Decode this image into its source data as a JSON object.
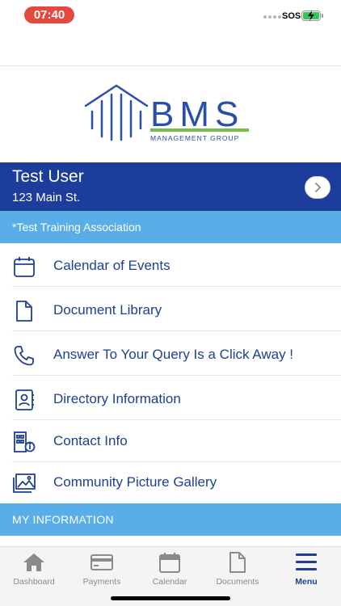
{
  "status_bar": {
    "time": "07:40",
    "carrier": "SOS"
  },
  "logo": {
    "name": "BMS",
    "tagline": "MANAGEMENT GROUP"
  },
  "user": {
    "name": "Test User",
    "address": "123 Main St."
  },
  "association": "*Test Training Association",
  "menu": [
    {
      "label": "Calendar of Events",
      "icon": "calendar-icon"
    },
    {
      "label": "Document Library",
      "icon": "document-icon"
    },
    {
      "label": "Answer To Your Query Is a Click Away !",
      "icon": "phone-icon"
    },
    {
      "label": "Directory Information",
      "icon": "directory-icon"
    },
    {
      "label": "Contact Info",
      "icon": "building-info-icon"
    },
    {
      "label": "Community Picture Gallery",
      "icon": "gallery-icon"
    }
  ],
  "section_header": "MY INFORMATION",
  "tabs": [
    {
      "label": "Dashboard",
      "icon": "home-icon",
      "active": false
    },
    {
      "label": "Payments",
      "icon": "credit-card-icon",
      "active": false
    },
    {
      "label": "Calendar",
      "icon": "calendar-icon",
      "active": false
    },
    {
      "label": "Documents",
      "icon": "document-icon",
      "active": false
    },
    {
      "label": "Menu",
      "icon": "hamburger-menu-icon",
      "active": true
    }
  ],
  "colors": {
    "primary": "#1c3d9c",
    "accent": "#5aaee8",
    "brand_green": "#72c04b",
    "text_blue": "#1d3f94"
  }
}
